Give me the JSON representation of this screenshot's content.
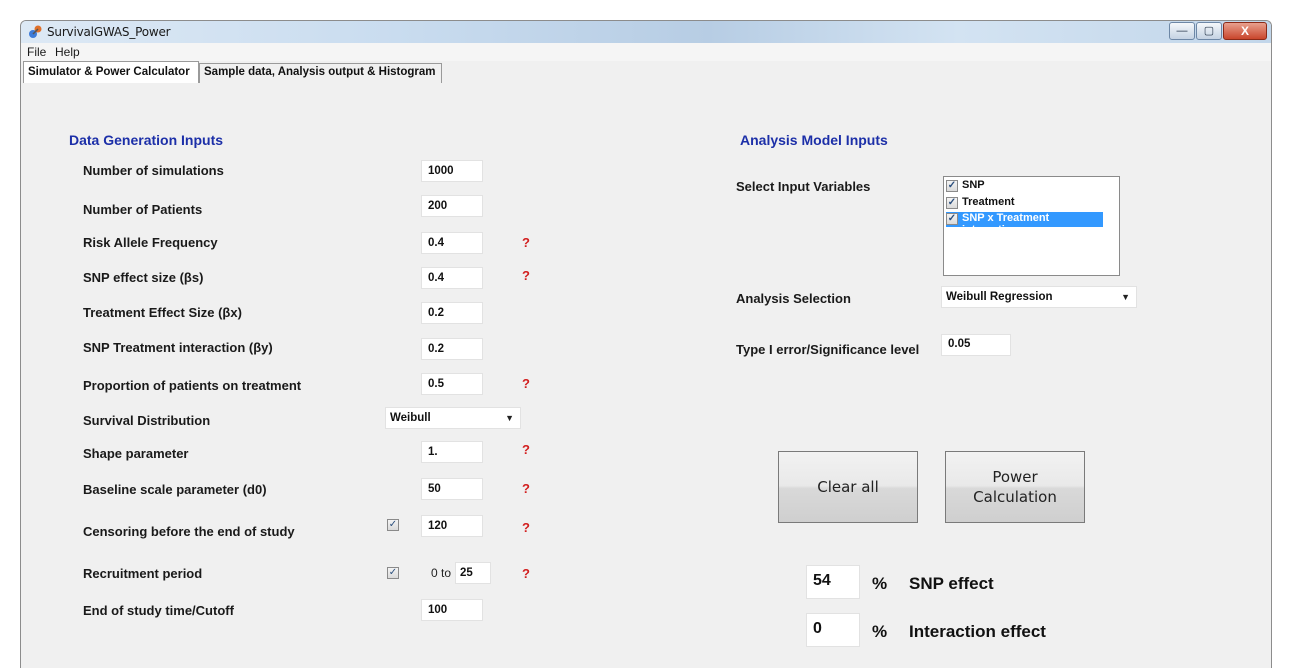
{
  "window": {
    "title": "SurvivalGWAS_Power",
    "controls": {
      "minimize": "—",
      "maximize": "▢",
      "close": "X"
    }
  },
  "menu": [
    "File",
    "Help"
  ],
  "tabs": [
    {
      "label": "Simulator & Power Calculator",
      "active": true
    },
    {
      "label": "Sample data, Analysis output & Histogram",
      "active": false
    }
  ],
  "data_generation": {
    "title": "Data Generation Inputs",
    "num_simulations": {
      "label": "Number of simulations",
      "value": "1000"
    },
    "num_patients": {
      "label": "Number of Patients",
      "value": "200"
    },
    "risk_allele_freq": {
      "label": "Risk Allele Frequency",
      "value": "0.4"
    },
    "snp_effect": {
      "label": "SNP effect size (βs)",
      "value": "0.4"
    },
    "treatment_effect": {
      "label": "Treatment Effect Size (βx)",
      "value": "0.2"
    },
    "interaction": {
      "label": "SNP Treatment interaction (βy)",
      "value": "0.2"
    },
    "proportion_treatment": {
      "label": "Proportion of patients on treatment",
      "value": "0.5"
    },
    "survival_distribution": {
      "label": "Survival Distribution",
      "value": "Weibull"
    },
    "shape": {
      "label": "Shape parameter",
      "value": "1."
    },
    "baseline_scale": {
      "label": "Baseline scale parameter (d0)",
      "value": "50"
    },
    "censoring": {
      "label": "Censoring before the end of study",
      "value": "120",
      "checked": true
    },
    "recruitment": {
      "label": "Recruitment period",
      "prefix": "0 to",
      "value": "25",
      "checked": true
    },
    "end_of_study": {
      "label": "End of study time/Cutoff",
      "value": "100"
    },
    "help_symbol": "?"
  },
  "analysis_model": {
    "title": "Analysis Model Inputs",
    "select_vars_label": "Select Input Variables",
    "variables": [
      {
        "label": "SNP",
        "checked": true
      },
      {
        "label": "Treatment",
        "checked": true
      },
      {
        "label": "SNP x Treatment interaction",
        "checked": true,
        "selected": true
      }
    ],
    "analysis_selection": {
      "label": "Analysis Selection",
      "value": "Weibull Regression"
    },
    "significance": {
      "label": "Type I error/Significance level",
      "value": "0.05"
    }
  },
  "buttons": {
    "clear_all": "Clear all",
    "power_calc": "Power\nCalculation"
  },
  "results": {
    "snp": {
      "value": "54",
      "unit": "%",
      "label": "SNP effect"
    },
    "interaction": {
      "value": "0",
      "unit": "%",
      "label": "Interaction effect"
    }
  },
  "colors": {
    "section_title": "#1c2fa8",
    "help": "#d21f1f",
    "selection": "#3399ff"
  }
}
